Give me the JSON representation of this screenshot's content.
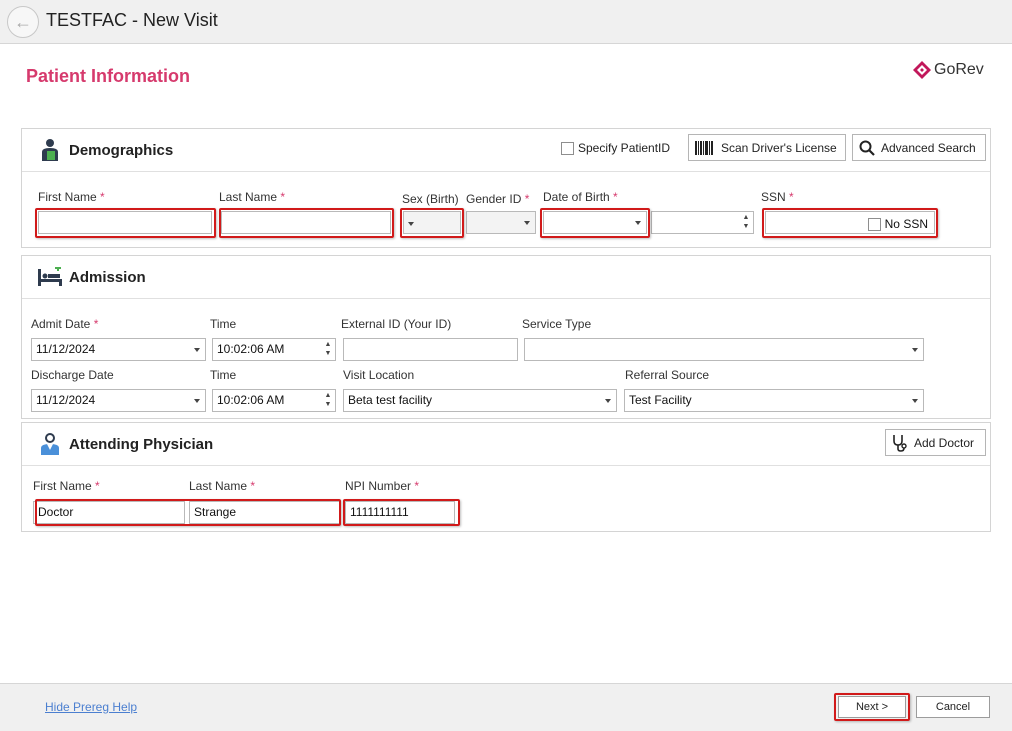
{
  "window": {
    "title": "TESTFAC - New Visit"
  },
  "page": {
    "section_title": "Patient Information",
    "logo_text": "GoRev"
  },
  "demographics": {
    "title": "Demographics",
    "specify_patient_id": "Specify PatientID",
    "scan_license": "Scan Driver's License",
    "advanced_search": "Advanced Search",
    "first_name_label": "First Name",
    "last_name_label": "Last Name",
    "sex_label": "Sex (Birth)",
    "gender_label": "Gender ID",
    "dob_label": "Date of Birth",
    "ssn_label": "SSN",
    "no_ssn": "No SSN",
    "first_name": "",
    "last_name": "",
    "ssn": ""
  },
  "admission": {
    "title": "Admission",
    "admit_date_label": "Admit Date",
    "time_label": "Time",
    "external_id_label": "External ID (Your ID)",
    "service_type_label": "Service Type",
    "discharge_date_label": "Discharge Date",
    "time2_label": "Time",
    "visit_location_label": "Visit Location",
    "referral_source_label": "Referral Source",
    "admit_date": "11/12/2024",
    "admit_time": "10:02:06 AM",
    "external_id": "",
    "service_type": "",
    "discharge_date": "11/12/2024",
    "discharge_time": "10:02:06 AM",
    "visit_location": "Beta test facility",
    "referral_source": "Test Facility"
  },
  "physician": {
    "title": "Attending Physician",
    "add_doctor": "Add Doctor",
    "first_name_label": "First Name",
    "last_name_label": "Last Name",
    "npi_label": "NPI Number",
    "first_name": "Doctor",
    "last_name": "Strange",
    "npi": "1111111111"
  },
  "footer": {
    "hide_help": "Hide Prereg Help",
    "next": "Next >",
    "cancel": "Cancel"
  },
  "required_marker": "*",
  "colors": {
    "accent": "#d63a6d",
    "highlight": "#d11a1a",
    "link": "#4b7fd0"
  }
}
